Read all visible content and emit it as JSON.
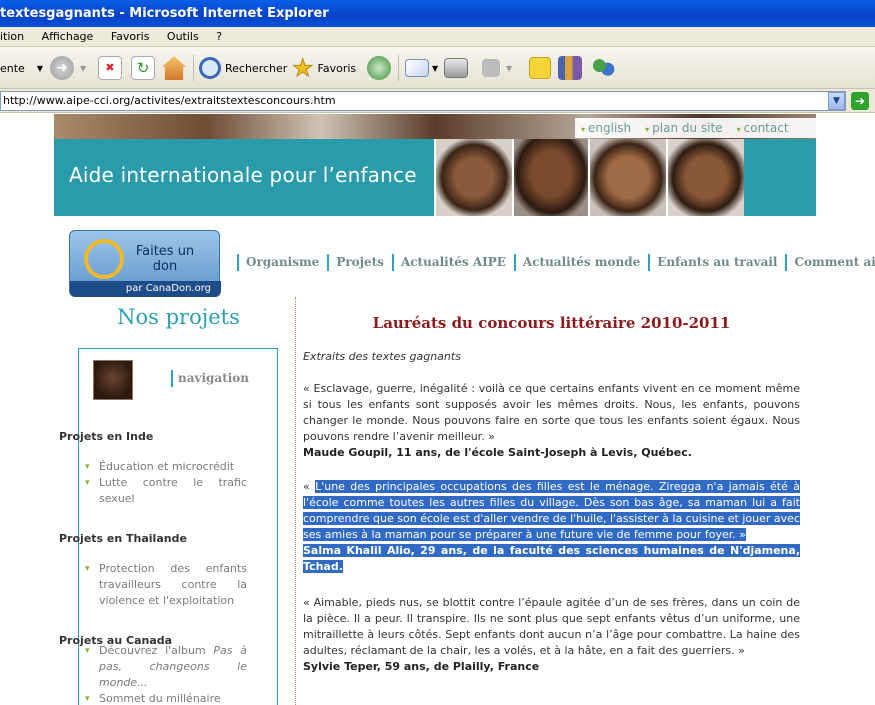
{
  "window": {
    "title": "textesgagnants - Microsoft Internet Explorer"
  },
  "menu": [
    "ition",
    "Affichage",
    "Favoris",
    "Outils",
    "?"
  ],
  "toolbar": {
    "back_label": "ente",
    "search_label": "Rechercher",
    "favorites_label": "Favoris"
  },
  "address": {
    "url": "http://www.aipe-cci.org/activites/extraitstextesconcours.htm"
  },
  "site": {
    "toplinks": [
      "english",
      "plan du site",
      "contact"
    ],
    "banner_title": "Aide internationale pour l’enfance",
    "donate": {
      "line1": "Faites un",
      "line2": "don",
      "sub": "par CanaDon.org"
    },
    "nav": [
      "Organisme",
      "Projets",
      "Actualités AIPE",
      "Actualités monde",
      "Enfants au travail",
      "Comment aider"
    ]
  },
  "sidebar": {
    "heading": "Nos projets",
    "navigation_label": "navigation",
    "cat_inde": "Projets en Inde",
    "inde_item1": "Éducation et microcrédit",
    "inde_item2": "Lutte contre le trafic sexuel",
    "cat_thai": "Projets en Thailande",
    "thai_item1": "Protection des enfants travailleurs contre la violence et l'exploitation",
    "cat_canada": "Projets au Canada",
    "canada_item1a": "Découvrez l'album ",
    "canada_item1b": "Pas à pas, changeons le monde...",
    "canada_item2": "Sommet du millénaire"
  },
  "article": {
    "title": "Lauréats du concours littéraire 2010-2011",
    "subtitle": "Extraits des textes gagnants",
    "p1": "« Esclavage, guerre, inégalité : voilà ce que certains enfants vivent en ce moment même si tous les enfants sont supposés avoir les mêmes droits. Nous, les enfants, pouvons changer le monde. Nous pouvons faire en sorte que tous les enfants soient égaux. Nous pouvons rendre l’avenir meilleur. »",
    "a1": "Maude Goupil, 11 ans, de l'école Saint-Joseph à Levis, Québec.",
    "p2_open": "« ",
    "p2": "L'une des principales occupations des filles est le ménage. Ziregga n'a jamais été à l'école comme toutes les autres filles du village. Dès son bas âge, sa maman lui a fait comprendre que son école est d'aller vendre de l'huile, l'assister à la cuisine et jouer avec ses amies à la maman pour se préparer à une future vie de femme pour foyer. »",
    "a2": "Salma Khalil Alio, 29 ans, de la faculté des sciences humaines de N'djamena, Tchad. ",
    "p3": "« Aimable, pieds nus, se blottit contre l’épaule agitée d’un de ses frères, dans un coin de la pièce. Il a peur. Il transpire. Ils ne sont plus que sept enfants vêtus d’un uniforme, une mitraillette à leurs côtés. Sept enfants dont aucun n’a l’âge pour combattre. La haine des adultes, réclamant de la chair, les a volés, et à la hâte, en a fait des guerriers. »",
    "a3": "Sylvie Teper, 59 ans, de Plailly, France"
  }
}
